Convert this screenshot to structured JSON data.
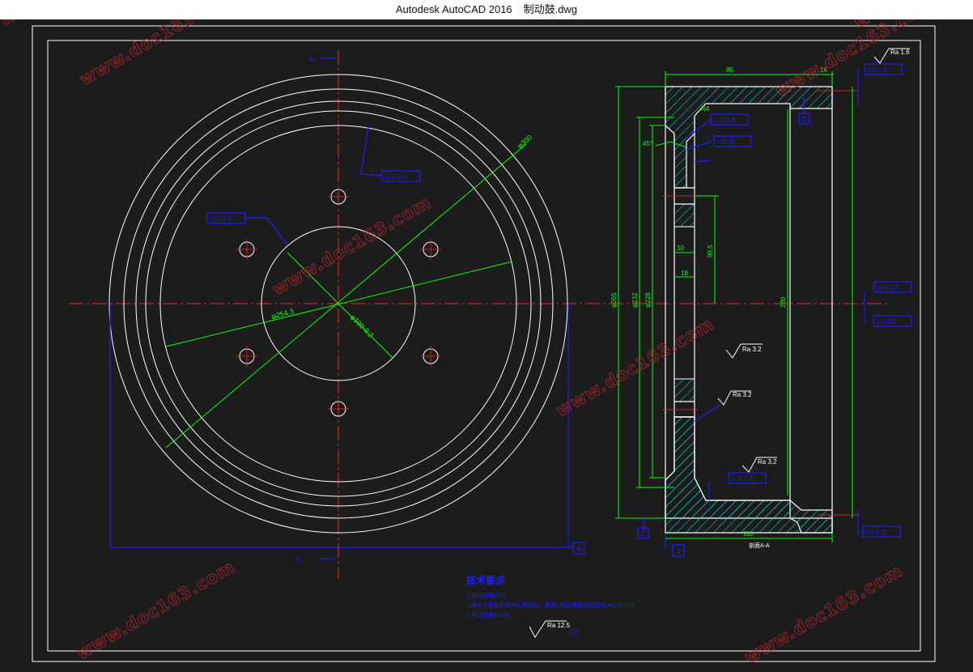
{
  "window": {
    "app_title": "Autodesk AutoCAD 2016",
    "document_name": "制动鼓.dwg"
  },
  "colors": {
    "background": "#1c1c1c",
    "geometry": "#ffffff",
    "centerline": "#ff2020",
    "dimension": "#00ff00",
    "hatch": "#00e5e5",
    "annotation": "#1e1eff",
    "watermark": "#c0272d"
  },
  "drawing": {
    "section_marker_top": "A",
    "section_marker_bottom": "A",
    "section_view_label": "剖面A-A",
    "front_view": {
      "dim_outer_dia": "φ300",
      "dim_bolt_circle": "φ254.3",
      "dim_hub_dia": "φ190-0.2",
      "tol_top": "⊥ 0.1 A",
      "tol_left": "◎ 0.1 A",
      "datum_right": "A"
    },
    "side_view": {
      "dim_top_width": "85",
      "dim_small_top": "16",
      "dim_chamfer": "45°",
      "dim_r": "R4",
      "dim_10": "10",
      "dim_18": "18",
      "dim_h": "99.5",
      "dim_phi_a": "φ265",
      "dim_phi_b": "φ232",
      "dim_phi_c": "φ228",
      "dim_inner": "280",
      "dim_bottom_width": "110",
      "datum_b": "B",
      "datum_c": "C",
      "datum_d": "D",
      "tol_1": "// 0.1 A",
      "tol_2": "⊥ 0.1 B",
      "tol_3": "○ 0.05",
      "tol_4": "◎ 0.1 C",
      "tol_5": "⌭ 0.05",
      "tol_6": "⊥ 0.1 A",
      "tol_7": "// 0.1 D",
      "rough_1": "Ra 1.6",
      "rough_2": "Ra 3.2",
      "rough_3": "Ra 3.2",
      "rough_4": "Ra 3.2"
    },
    "notes": {
      "title": "技术要求",
      "line1": "1.未注倒角C1.5",
      "line2": "2.铸件不得有砂眼气孔等缺陷，表面1.制动面硬度范围为HB190-230",
      "line3": "3.未注圆角R3-R5",
      "roughness_general": "Ra 12.5",
      "roughness_suffix": "(√)"
    }
  },
  "watermark_text": "www.doc163.com"
}
